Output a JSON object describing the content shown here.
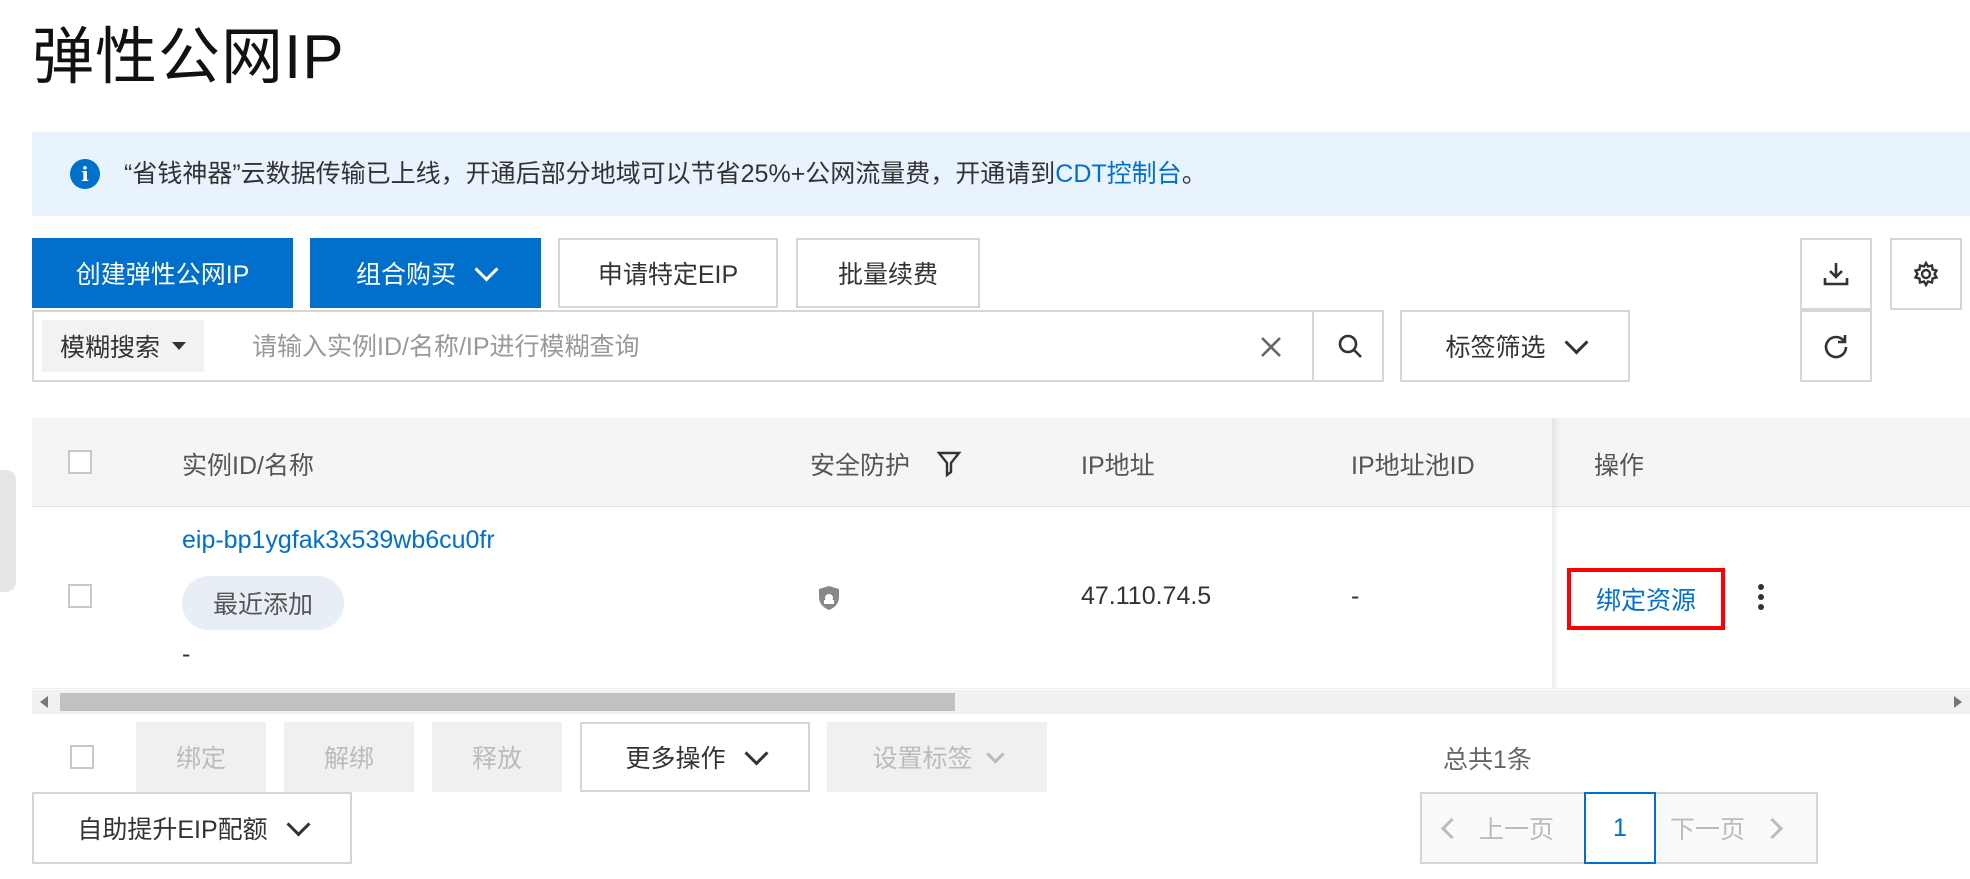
{
  "page": {
    "title": "弹性公网IP"
  },
  "notice": {
    "text_prefix": "“省钱神器”云数据传输已上线，开通后部分地域可以节省25%+公网流量费，开通请到",
    "link": "CDT控制台",
    "text_suffix": "。"
  },
  "toolbar": {
    "create_label": "创建弹性公网IP",
    "combo_label": "组合购买",
    "apply_label": "申请特定EIP",
    "renew_label": "批量续费"
  },
  "search": {
    "mode_label": "模糊搜索",
    "placeholder": "请输入实例ID/名称/IP进行模糊查询",
    "value": ""
  },
  "tag_filter": {
    "label": "标签筛选"
  },
  "table": {
    "columns": {
      "instance": "实例ID/名称",
      "security": "安全防护",
      "ip": "IP地址",
      "pool": "IP地址池ID",
      "ops": "操作"
    },
    "rows": [
      {
        "instance_id": "eip-bp1ygfak3x539wb6cu0fr",
        "badge": "最近添加",
        "name": "-",
        "ip": "47.110.74.5",
        "pool_id": "-",
        "op_bind": "绑定资源"
      }
    ]
  },
  "bottom_actions": {
    "bind": "绑定",
    "unbind": "解绑",
    "release": "释放",
    "more": "更多操作",
    "set_tag": "设置标签",
    "quota": "自助提升EIP配额",
    "total": "总共1条"
  },
  "pagination": {
    "prev": "上一页",
    "current": "1",
    "next": "下一页"
  },
  "colors": {
    "primary": "#0070cc",
    "notice_bg": "#e9f3fd",
    "highlight": "#ff0000"
  }
}
